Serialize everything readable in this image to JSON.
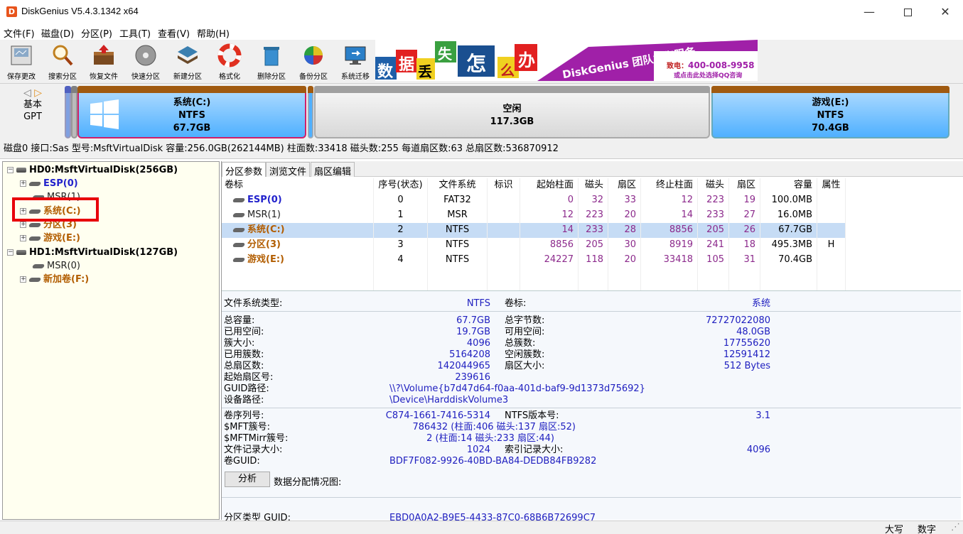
{
  "window": {
    "title": "DiskGenius V5.4.3.1342 x64"
  },
  "menu": [
    "文件(F)",
    "磁盘(D)",
    "分区(P)",
    "工具(T)",
    "查看(V)",
    "帮助(H)"
  ],
  "toolbar": [
    {
      "label": "保存更改",
      "icon": "save-icon"
    },
    {
      "label": "搜索分区",
      "icon": "search-icon"
    },
    {
      "label": "恢复文件",
      "icon": "recover-icon"
    },
    {
      "label": "快速分区",
      "icon": "disc-icon"
    },
    {
      "label": "新建分区",
      "icon": "layers-icon"
    },
    {
      "label": "格式化",
      "icon": "lifebuoy-icon"
    },
    {
      "label": "删除分区",
      "icon": "trash-icon"
    },
    {
      "label": "备份分区",
      "icon": "pie-icon"
    },
    {
      "label": "系统迁移",
      "icon": "monitor-icon"
    }
  ],
  "ad": {
    "chars": [
      "数",
      "据",
      "丢",
      "失",
      "怎",
      "么",
      "办"
    ],
    "slogan": "DiskGenius 团队为您服务",
    "phone_label": "致电：",
    "phone": "400-008-9958",
    "qq": "或点击此处选择QQ咨询"
  },
  "disk_nav": {
    "type": "基本",
    "scheme": "GPT"
  },
  "disk_map": [
    {
      "name": "系统(C:)",
      "fs": "NTFS",
      "size": "67.7GB"
    },
    {
      "name": "空闲",
      "fs": "",
      "size": "117.3GB"
    },
    {
      "name": "游戏(E:)",
      "fs": "NTFS",
      "size": "70.4GB"
    }
  ],
  "disk_info": "磁盘0 接口:Sas  型号:MsftVirtualDisk  容量:256.0GB(262144MB)  柱面数:33418  磁头数:255  每道扇区数:63  总扇区数:536870912",
  "tree": {
    "disks": [
      {
        "label": "HD0:MsftVirtualDisk(256GB)",
        "parts": [
          "ESP(0)",
          "MSR(1)",
          "系统(C:)",
          "分区(3)",
          "游戏(E:)"
        ]
      },
      {
        "label": "HD1:MsftVirtualDisk(127GB)",
        "parts": [
          "MSR(0)",
          "新加卷(F:)"
        ]
      }
    ]
  },
  "tabs": [
    "分区参数",
    "浏览文件",
    "扇区编辑"
  ],
  "table": {
    "headers": [
      "卷标",
      "序号(状态)",
      "文件系统",
      "标识",
      "起始柱面",
      "磁头",
      "扇区",
      "终止柱面",
      "磁头",
      "扇区",
      "容量",
      "属性"
    ],
    "rows": [
      [
        "ESP(0)",
        "0",
        "FAT32",
        "",
        "0",
        "32",
        "33",
        "12",
        "223",
        "19",
        "100.0MB",
        ""
      ],
      [
        "MSR(1)",
        "1",
        "MSR",
        "",
        "12",
        "223",
        "20",
        "14",
        "233",
        "27",
        "16.0MB",
        ""
      ],
      [
        "系统(C:)",
        "2",
        "NTFS",
        "",
        "14",
        "233",
        "28",
        "8856",
        "205",
        "26",
        "67.7GB",
        ""
      ],
      [
        "分区(3)",
        "3",
        "NTFS",
        "",
        "8856",
        "205",
        "30",
        "8919",
        "241",
        "18",
        "495.3MB",
        "H"
      ],
      [
        "游戏(E:)",
        "4",
        "NTFS",
        "",
        "24227",
        "118",
        "20",
        "33418",
        "105",
        "31",
        "70.4GB",
        ""
      ]
    ]
  },
  "details": {
    "fs_type_label": "文件系统类型:",
    "fs_type": "NTFS",
    "vol_label_label": "卷标:",
    "vol_label": "系统",
    "total_cap_label": "总容量:",
    "total_cap": "67.7GB",
    "total_bytes_label": "总字节数:",
    "total_bytes": "72727022080",
    "used_label": "已用空间:",
    "used": "19.7GB",
    "free_label": "可用空间:",
    "free": "48.0GB",
    "cluster_label": "簇大小:",
    "cluster": "4096",
    "total_clusters_label": "总簇数:",
    "total_clusters": "17755620",
    "used_clusters_label": "已用簇数:",
    "used_clusters": "5164208",
    "free_clusters_label": "空闲簇数:",
    "free_clusters": "12591412",
    "total_sectors_label": "总扇区数:",
    "total_sectors": "142044965",
    "sector_size_label": "扇区大小:",
    "sector_size": "512 Bytes",
    "start_sector_label": "起始扇区号:",
    "start_sector": "239616",
    "guid_path_label": "GUID路径:",
    "guid_path": "\\\\?\\Volume{b7d47d64-f0aa-401d-baf9-9d1373d75692}",
    "dev_path_label": "设备路径:",
    "dev_path": "\\Device\\HarddiskVolume3",
    "serial_label": "卷序列号:",
    "serial": "C874-1661-7416-5314",
    "ntfs_ver_label": "NTFS版本号:",
    "ntfs_ver": "3.1",
    "mft_label": "$MFT簇号:",
    "mft": "786432 (柱面:406 磁头:137 扇区:52)",
    "mftmirr_label": "$MFTMirr簇号:",
    "mftmirr": "2 (柱面:14 磁头:233 扇区:44)",
    "rec_size_label": "文件记录大小:",
    "rec_size": "1024",
    "idx_size_label": "索引记录大小:",
    "idx_size": "4096",
    "vol_guid_label": "卷GUID:",
    "vol_guid": "BDF7F082-9926-40BD-BA84-DEDB84FB9282",
    "analyze": "分析",
    "alloc": "数据分配情况图:",
    "ptype_guid_label": "分区类型 GUID:",
    "ptype_guid": "EBD0A0A2-B9E5-4433-87C0-68B6B72699C7"
  },
  "status": {
    "caps": "大写",
    "num": "数字"
  }
}
